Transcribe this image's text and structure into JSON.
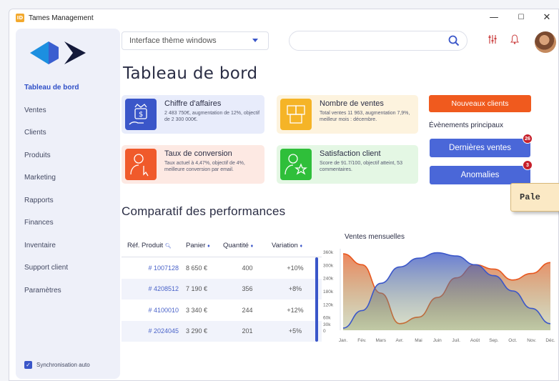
{
  "window": {
    "title": "Tames Management",
    "app_icon": "ID",
    "controls": [
      "—",
      "☐",
      "✕"
    ]
  },
  "sidebar": {
    "items": [
      {
        "label": "Tableau de bord",
        "active": true
      },
      {
        "label": "Ventes"
      },
      {
        "label": "Clients"
      },
      {
        "label": "Produits"
      },
      {
        "label": "Marketing"
      },
      {
        "label": "Rapports"
      },
      {
        "label": "Finances"
      },
      {
        "label": "Inventaire"
      },
      {
        "label": "Support client"
      },
      {
        "label": "Paramètres"
      }
    ],
    "sync_label": "Synchronisation auto",
    "sync_checked": true
  },
  "header": {
    "theme_select": "Interface thème windows",
    "search_placeholder": "",
    "icons": [
      "search-icon",
      "filter-icon",
      "bell-icon",
      "avatar"
    ]
  },
  "page_title": "Tableau de bord",
  "cards": [
    {
      "title": "Chiffre d'affaires",
      "desc": "2 483 750€, augmentation de 12%, objectif de 2 300 000€.",
      "color": "#e8ecfb",
      "icon_color": "#3a56c9",
      "icon": "money-hand-icon"
    },
    {
      "title": "Nombre de ventes",
      "desc": "Total ventes 11 963, augmentation 7,9%, meilleur mois : décembre.",
      "color": "#fdf3de",
      "icon_color": "#f5b427",
      "icon": "boxes-icon"
    },
    {
      "title": "Taux de conversion",
      "desc": "Taux actuel à 4,47%, objectif de 4%, meilleure conversion par email.",
      "color": "#fde9e3",
      "icon_color": "#f05a2b",
      "icon": "person-click-icon"
    },
    {
      "title": "Satisfaction client",
      "desc": "Score de 91.7/100, objectif atteint, 53 commentaires.",
      "color": "#e4f7e4",
      "icon_color": "#2fbf3a",
      "icon": "person-star-icon"
    }
  ],
  "actions": {
    "nouveaux_clients": "Nouveaux clients",
    "events_title": "Évènements principaux",
    "dernieres_ventes": "Dernières ventes",
    "dernieres_ventes_badge": "26",
    "anomalies": "Anomalies",
    "anomalies_badge": "3"
  },
  "palette_tip": "Pale",
  "section_title": "Comparatif des performances",
  "table": {
    "headers": [
      "Réf. Produit",
      "Panier",
      "Quantité",
      "Variation"
    ],
    "rows": [
      [
        "# 1007128",
        "8 650 €",
        "400",
        "+10%"
      ],
      [
        "# 4208512",
        "7 190 €",
        "356",
        "+8%"
      ],
      [
        "# 4100010",
        "3 340 €",
        "244",
        "+12%"
      ],
      [
        "# 2024045",
        "3 290 €",
        "201",
        "+5%"
      ]
    ]
  },
  "chart_data": {
    "type": "area",
    "title": "Ventes mensuelles",
    "categories": [
      "Jan.",
      "Fév.",
      "Mars",
      "Avr.",
      "Mai",
      "Juin",
      "Juil.",
      "Août",
      "Sep.",
      "Oct.",
      "Nov.",
      "Déc."
    ],
    "y_ticks": [
      "0",
      "30k",
      "60k",
      "120k",
      "180k",
      "240k",
      "300k",
      "360k"
    ],
    "series": [
      {
        "values": [
          10,
          90,
          215,
          290,
          330,
          355,
          340,
          300,
          250,
          180,
          100,
          30
        ],
        "color": "#3a56c9"
      },
      {
        "values": [
          350,
          300,
          170,
          30,
          60,
          150,
          240,
          300,
          280,
          230,
          260,
          310
        ],
        "color": "#e8581f"
      }
    ],
    "ylim": [
      0,
      360
    ]
  }
}
